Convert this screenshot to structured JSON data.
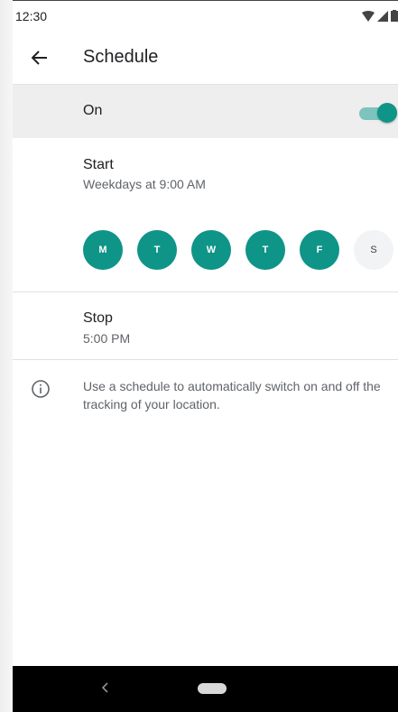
{
  "status_bar": {
    "time": "12:30"
  },
  "app_bar": {
    "back_icon": "arrow-left-icon",
    "title": "Schedule"
  },
  "on_row": {
    "label": "On",
    "toggle_state": true
  },
  "start": {
    "title": "Start",
    "subtitle": "Weekdays at 9:00 AM"
  },
  "days": [
    {
      "label": "M",
      "selected": true
    },
    {
      "label": "T",
      "selected": true
    },
    {
      "label": "W",
      "selected": true
    },
    {
      "label": "T",
      "selected": true
    },
    {
      "label": "F",
      "selected": true
    },
    {
      "label": "S",
      "selected": false
    }
  ],
  "stop": {
    "title": "Stop",
    "subtitle": "5:00 PM"
  },
  "info": {
    "icon": "info-icon",
    "text": "Use a schedule to automatically switch on and off the tracking of your location."
  },
  "colors": {
    "accent": "#0f9488",
    "accent_light": "#7cc4bd",
    "row_highlight": "#eeeeee"
  }
}
